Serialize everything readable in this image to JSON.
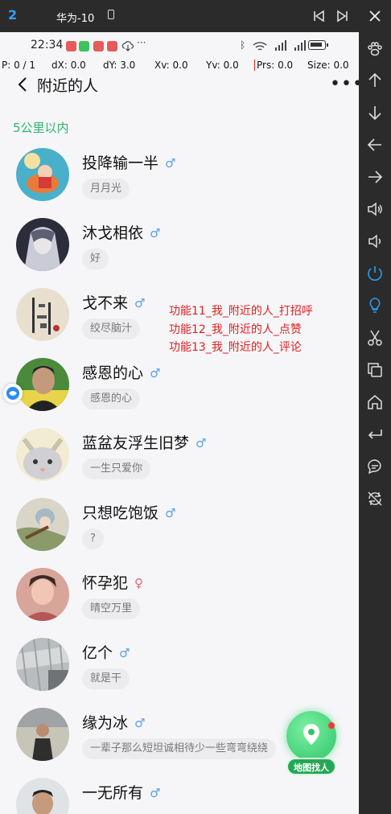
{
  "window": {
    "instance_number": "2",
    "title": "华为-10"
  },
  "status_bar": {
    "time": "22:34",
    "more": "···"
  },
  "pointer_info": {
    "p": "P: 0 / 1",
    "dx": "dX: 0.0",
    "dy": "dY: 3.0",
    "xv": "Xv: 0.0",
    "yv": "Yv: 0.0",
    "prs": "Prs: 0.0",
    "size": "Size: 0.0"
  },
  "nav": {
    "title": "附近的人",
    "more": "•••"
  },
  "section_label": "5公里以内",
  "overlay_text": [
    "功能11_我_附近的人_打招呼",
    "功能12_我_附近的人_点赞",
    "功能13_我_附近的人_评论"
  ],
  "people": [
    {
      "name": "投降输一半",
      "gender": "♂",
      "gender_type": "male",
      "signature": "月月光"
    },
    {
      "name": "沐戈相依",
      "gender": "♂",
      "gender_type": "male",
      "signature": "好"
    },
    {
      "name": "戈不来",
      "gender": "♂",
      "gender_type": "male",
      "signature": "绞尽脑汁"
    },
    {
      "name": "感恩的心",
      "gender": "♂",
      "gender_type": "male",
      "signature": "感恩的心"
    },
    {
      "name": "蓝盆友浮生旧梦",
      "gender": "♂",
      "gender_type": "male",
      "signature": "一生只爱你"
    },
    {
      "name": "只想吃饱饭",
      "gender": "♂",
      "gender_type": "male",
      "signature": "?"
    },
    {
      "name": "怀孕犯",
      "gender": "♀",
      "gender_type": "female",
      "signature": "晴空万里"
    },
    {
      "name": "亿个",
      "gender": "♂",
      "gender_type": "male",
      "signature": "就是干"
    },
    {
      "name": "缘为冰",
      "gender": "♂",
      "gender_type": "male",
      "signature": "一辈子那么短坦诚相待少一些弯弯绕绕"
    },
    {
      "name": "一无所有",
      "gender": "♂",
      "gender_type": "male",
      "signature": ""
    }
  ],
  "map_button": {
    "label": "地图找人"
  },
  "colors": {
    "accent_green": "#31b36d",
    "male": "#5aa0e8",
    "female": "#e8607a",
    "overlay_red": "#e02020",
    "chrome": "#2b2b2b"
  }
}
